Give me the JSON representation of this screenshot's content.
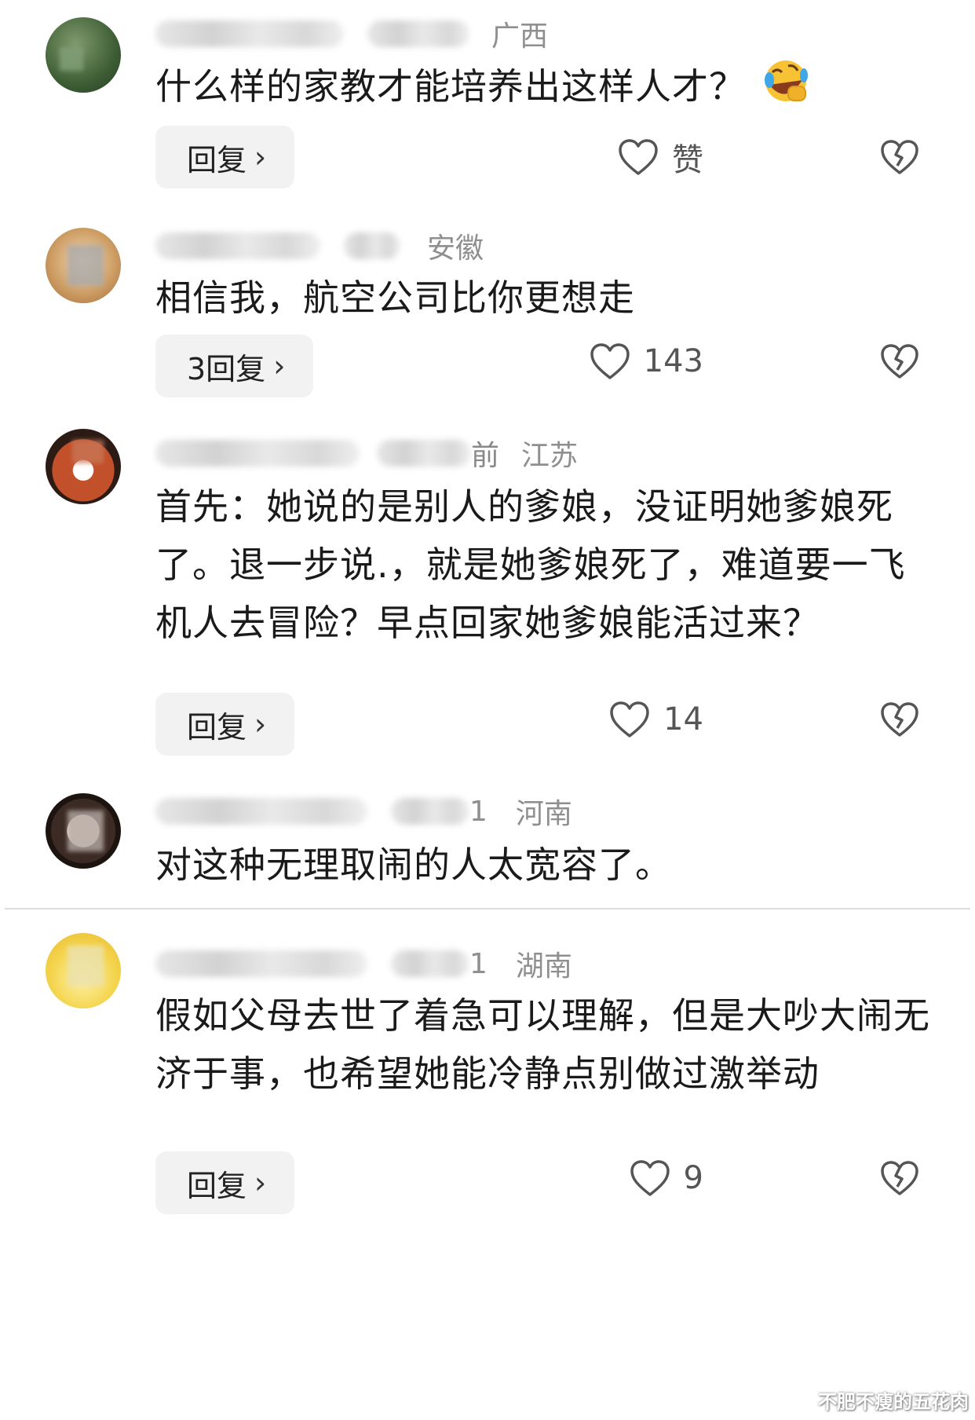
{
  "comments": [
    {
      "location": "广西",
      "text": "什么样的家教才能培养出这样人才？",
      "emoji": "rolling-on-floor-laughing-emoji",
      "reply_label": "回复",
      "like_label": "赞"
    },
    {
      "location": "安徽",
      "text": "相信我，航空公司比你更想走",
      "reply_label": "3回复",
      "like_label": "143"
    },
    {
      "location": "江苏",
      "time": "前",
      "text": "首先：她说的是别人的爹娘，没证明她爹娘死了。退一步说.，就是她爹娘死了，难道要一飞机人去冒险？早点回家她爹娘能活过来？",
      "reply_label": "回复",
      "like_label": "14"
    },
    {
      "location": "河南",
      "time_suffix": "1",
      "text": "对这种无理取闹的人太宽容了。"
    },
    {
      "location": "湖南",
      "time_suffix": "1",
      "text": "假如父母去世了着急可以理解，但是大吵大闹无济于事，也希望她能冷静点别做过激举动",
      "reply_label": "回复",
      "like_label": "9"
    }
  ],
  "icons": {
    "reply_chevron": "chevron-right-icon",
    "like": "heart-outline-icon",
    "dislike": "broken-heart-icon"
  },
  "chevron": "›",
  "watermark": "不肥不瘦的五花肉",
  "colors": {
    "text": "#1a1a1a",
    "meta": "#8f8f8f",
    "button_bg": "#f2f2f2",
    "icon": "#555555"
  }
}
